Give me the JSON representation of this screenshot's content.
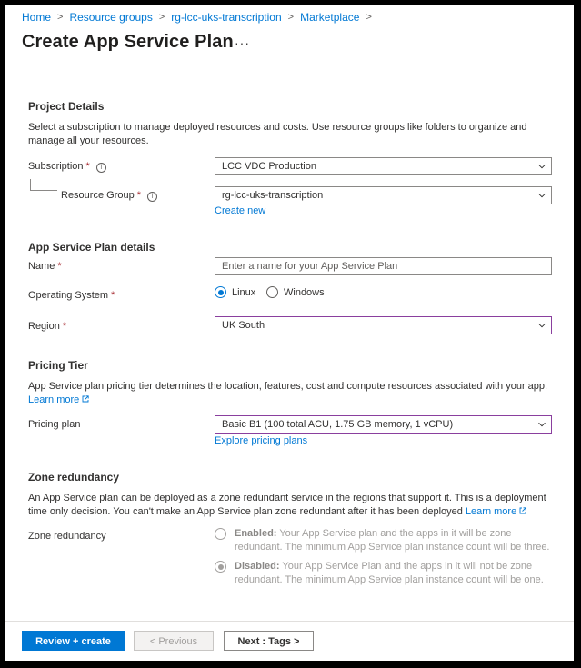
{
  "breadcrumb": [
    "Home",
    "Resource groups",
    "rg-lcc-uks-transcription",
    "Marketplace"
  ],
  "page_title": "Create App Service Plan",
  "more_label": "···",
  "project_details": {
    "title": "Project Details",
    "description": "Select a subscription to manage deployed resources and costs. Use resource groups like folders to organize and manage all your resources.",
    "subscription_label": "Subscription",
    "subscription_value": "LCC VDC Production",
    "resource_group_label": "Resource Group",
    "resource_group_value": "rg-lcc-uks-transcription",
    "create_new": "Create new"
  },
  "plan_details": {
    "title": "App Service Plan details",
    "name_label": "Name",
    "name_value": "",
    "name_placeholder": "Enter a name for your App Service Plan",
    "os_label": "Operating System",
    "os_options": [
      "Linux",
      "Windows"
    ],
    "os_selected": "Linux",
    "region_label": "Region",
    "region_value": "UK South"
  },
  "pricing": {
    "title": "Pricing Tier",
    "description": "App Service plan pricing tier determines the location, features, cost and compute resources associated with your app.",
    "learn_more": "Learn more",
    "plan_label": "Pricing plan",
    "plan_value": "Basic B1 (100 total ACU, 1.75 GB memory, 1 vCPU)",
    "explore": "Explore pricing plans"
  },
  "zone": {
    "title": "Zone redundancy",
    "description": "An App Service plan can be deployed as a zone redundant service in the regions that support it. This is a deployment time only decision. You can't make an App Service plan zone redundant after it has been deployed",
    "learn_more": "Learn more",
    "label": "Zone redundancy",
    "enabled_title": "Enabled:",
    "enabled_text": "Your App Service plan and the apps in it will be zone redundant. The minimum App Service plan instance count will be three.",
    "disabled_title": "Disabled:",
    "disabled_text": "Your App Service Plan and the apps in it will not be zone redundant. The minimum App Service plan instance count will be one.",
    "selected": "Disabled"
  },
  "footer": {
    "review_create": "Review + create",
    "previous": "< Previous",
    "next": "Next : Tags >"
  },
  "colors": {
    "accent": "#0078d4",
    "required": "#a4262c",
    "focus_border": "#8a3f9e"
  }
}
